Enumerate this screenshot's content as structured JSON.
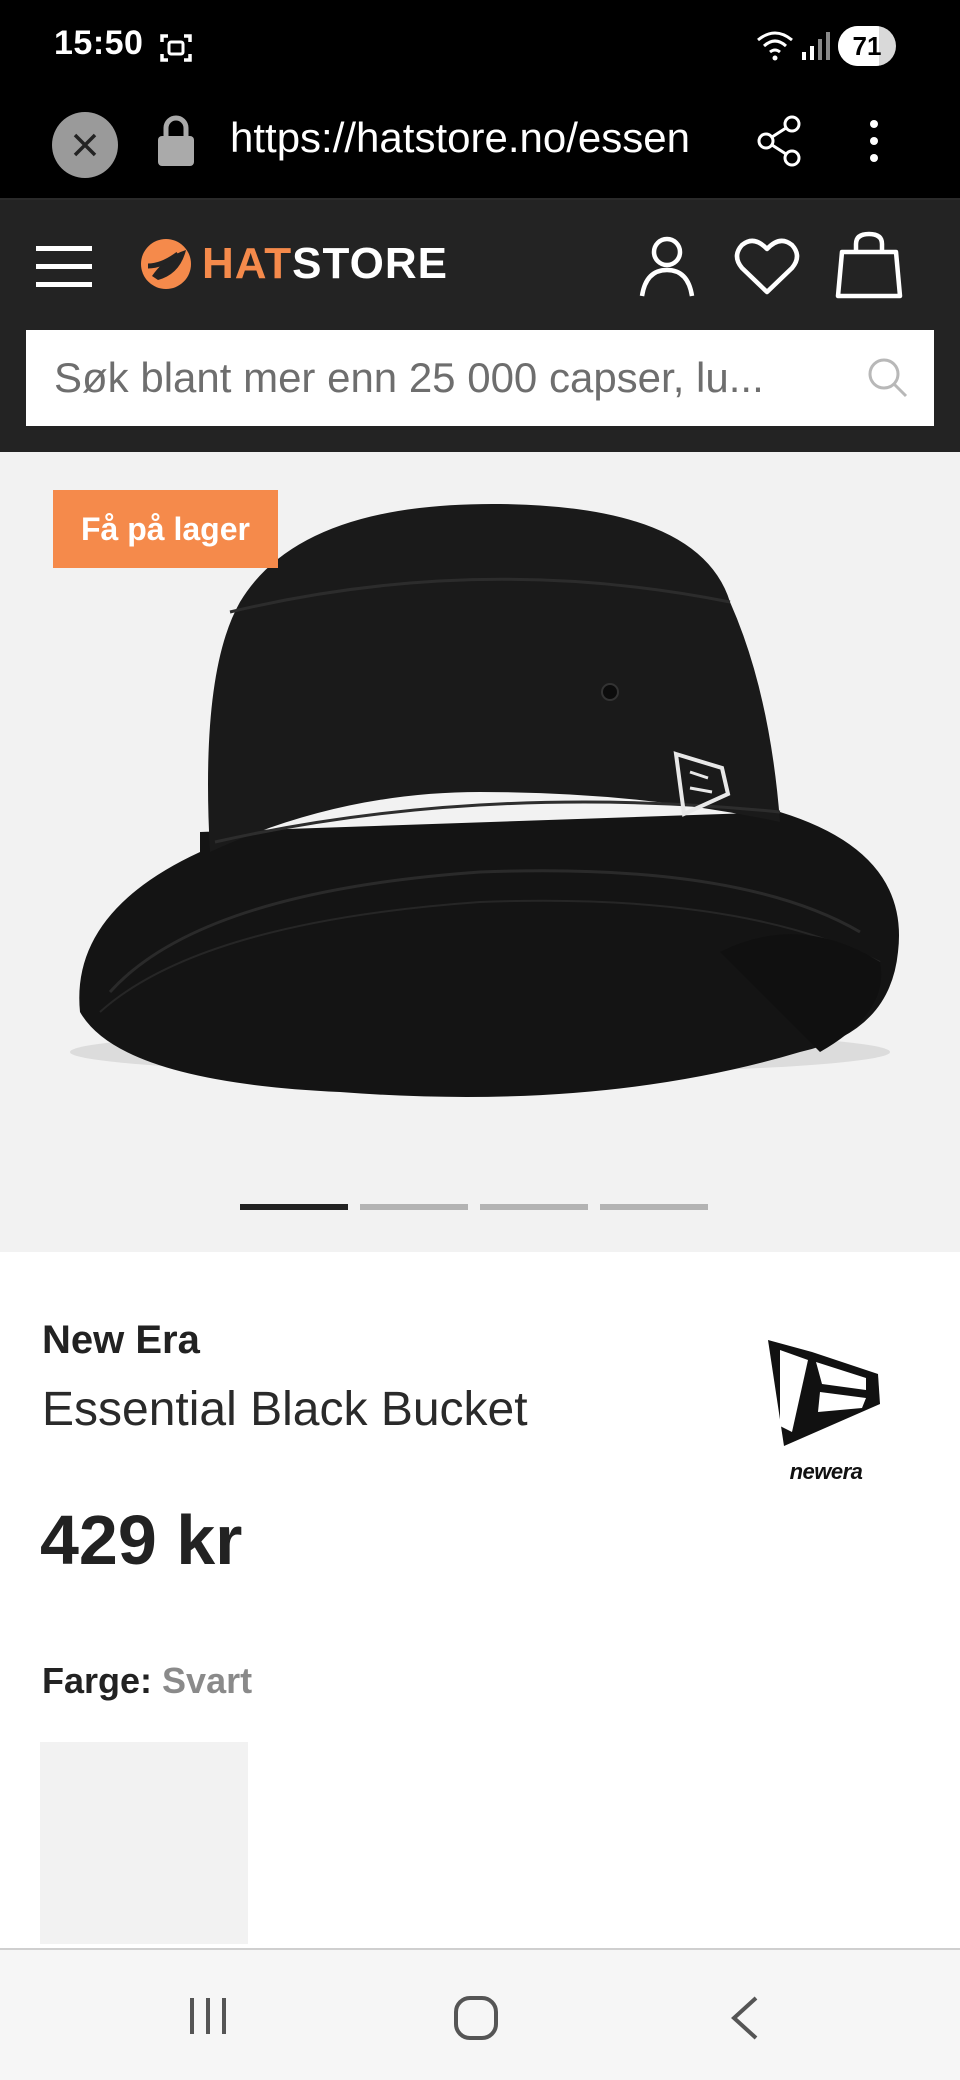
{
  "status_bar": {
    "time": "15:50",
    "battery": "71",
    "battery_level": 0.71
  },
  "browser": {
    "url": "https://hatstore.no/essen"
  },
  "site": {
    "logo_hat": "HAT",
    "logo_store": "STORE",
    "search_placeholder": "Søk blant mer enn 25 000 capser, lu..."
  },
  "gallery": {
    "badge": "Få på lager",
    "image_count": 4,
    "active_index": 0
  },
  "product": {
    "brand": "New Era",
    "name": "Essential Black Bucket",
    "price": "429 kr",
    "color_label": "Farge:",
    "color_value": "Svart",
    "brand_logo_text": "NEWERA"
  },
  "colors": {
    "accent": "#f58a4b",
    "header_bg": "#232323",
    "image_bg": "#f2f2f2"
  },
  "icons": [
    "screenshot-icon",
    "wifi-icon",
    "signal-icon",
    "close-icon",
    "lock-icon",
    "share-icon",
    "more-icon",
    "hamburger-icon",
    "user-icon",
    "heart-icon",
    "bag-icon",
    "search-icon",
    "recent-apps-icon",
    "home-icon",
    "back-icon"
  ]
}
